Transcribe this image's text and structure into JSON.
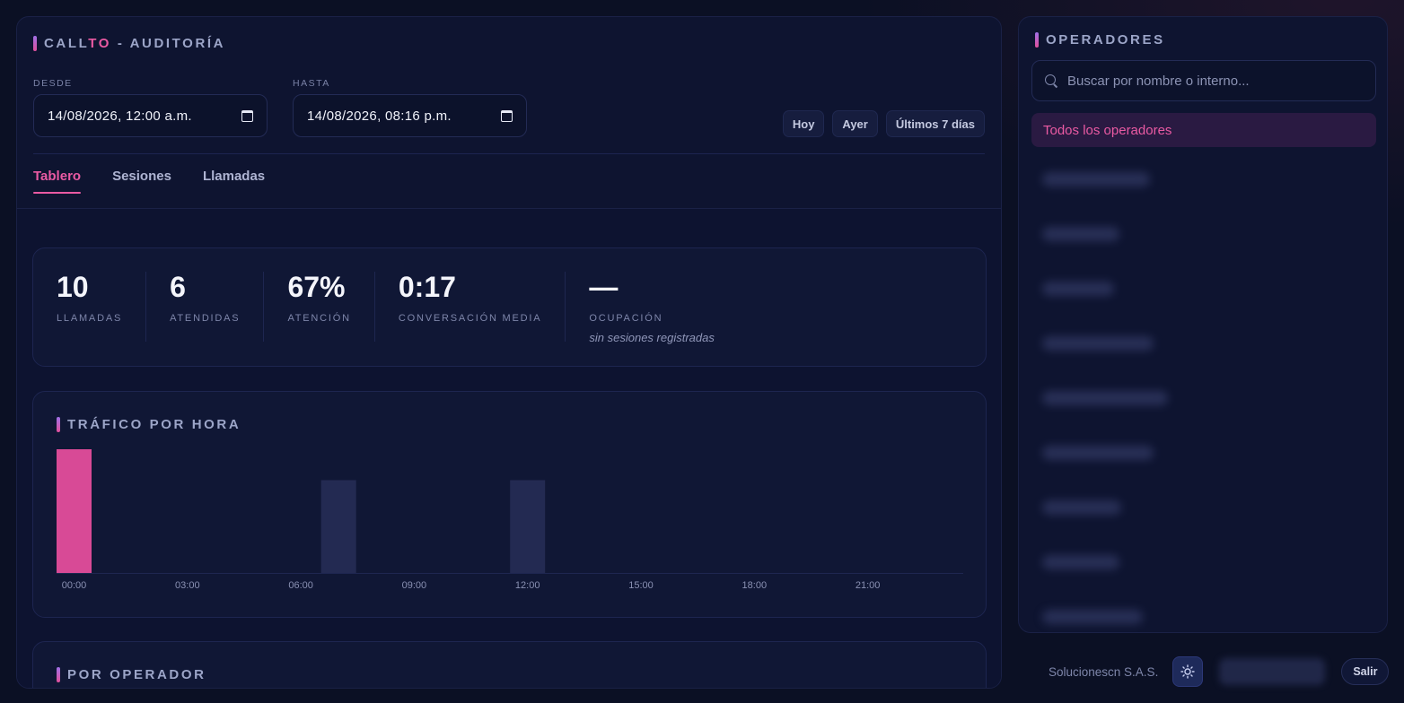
{
  "header": {
    "title_pre": "CALL",
    "title_accent": "TO",
    "title_post": " - AUDITORÍA"
  },
  "filters": {
    "from_label": "DESDE",
    "from_value": "14/08/2026, 12:00 a.m.",
    "to_label": "HASTA",
    "to_value": "14/08/2026, 08:16 p.m.",
    "quick": [
      "Hoy",
      "Ayer",
      "Últimos 7 días"
    ]
  },
  "tabs": [
    {
      "label": "Tablero",
      "active": true
    },
    {
      "label": "Sesiones",
      "active": false
    },
    {
      "label": "Llamadas",
      "active": false
    }
  ],
  "stats": [
    {
      "value": "10",
      "label": "LLAMADAS"
    },
    {
      "value": "6",
      "label": "ATENDIDAS"
    },
    {
      "value": "67%",
      "label": "ATENCIÓN"
    },
    {
      "value": "0:17",
      "label": "CONVERSACIÓN MEDIA"
    },
    {
      "value": "—",
      "label": "OCUPACIÓN",
      "sub": "sin sesiones registradas"
    }
  ],
  "traffic": {
    "title": "TRÁFICO POR HORA"
  },
  "by_operator": {
    "title": "POR OPERADOR"
  },
  "sidebar": {
    "title": "OPERADORES",
    "search_placeholder": "Buscar por nombre o interno...",
    "all_label": "Todos los operadores"
  },
  "footer": {
    "company": "Solucionescn S.A.S.",
    "logout": "Salir"
  },
  "colors": {
    "accent": "#ea5aa3",
    "bar_active": "#d84a96",
    "bar_default": "#232a52",
    "background": "#0b1024"
  },
  "chart_data": {
    "type": "bar",
    "title": "TRÁFICO POR HORA",
    "x": [
      0,
      1,
      2,
      3,
      4,
      5,
      6,
      7,
      8,
      9,
      10,
      11,
      12,
      13,
      14,
      15,
      16,
      17,
      18,
      19,
      20,
      21,
      22,
      23
    ],
    "values": [
      4,
      0,
      0,
      0,
      0,
      0,
      0,
      3,
      0,
      0,
      0,
      0,
      3,
      0,
      0,
      0,
      0,
      0,
      0,
      0,
      0,
      0,
      0,
      0
    ],
    "highlight_index": 0,
    "tick_labels": [
      "00:00",
      "03:00",
      "06:00",
      "09:00",
      "12:00",
      "15:00",
      "18:00",
      "21:00"
    ],
    "tick_positions": [
      0,
      3,
      6,
      9,
      12,
      15,
      18,
      21
    ],
    "ylim": [
      0,
      4
    ],
    "grid": false
  }
}
